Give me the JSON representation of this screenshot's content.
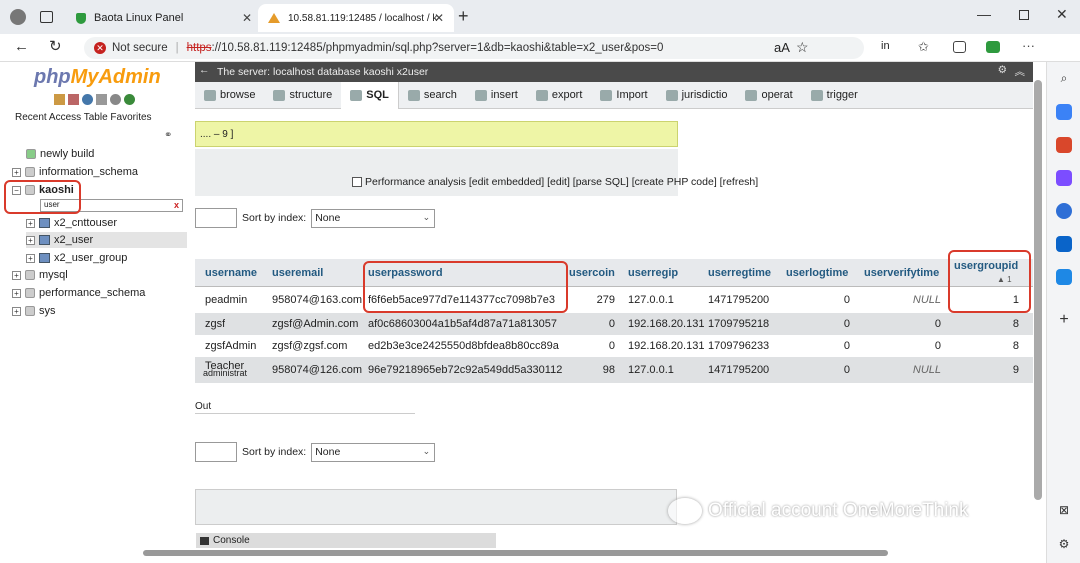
{
  "browser": {
    "tabs": [
      {
        "label": "Baota Linux Panel"
      },
      {
        "label": "10.58.81.119:12485 / localhost / k"
      }
    ],
    "security": "Not secure",
    "url_scheme": "https",
    "url_rest": "://10.58.81.119:12485/phpmyadmin/sql.php?server=1&db=kaoshi&table=x2_user&pos=0",
    "read_aloud": "aA",
    "lang": "in"
  },
  "sidebar": {
    "logo_php": "php",
    "logo_myadmin": "MyAdmin",
    "recent": "Recent Access Table Favorites",
    "new": "newly build",
    "databases": [
      "information_schema",
      "kaoshi"
    ],
    "filter_value": "user",
    "filter_clear": "x",
    "tables": [
      "x2_cnttouser",
      "x2_user",
      "x2_user_group"
    ],
    "more_databases": [
      "mysql",
      "performance_schema",
      "sys"
    ]
  },
  "main": {
    "server_bar": "The server: localhost database kaoshi x2user",
    "toolbar": [
      {
        "label": "browse"
      },
      {
        "label": "structure"
      },
      {
        "label": "SQL"
      },
      {
        "label": "search"
      },
      {
        "label": "insert"
      },
      {
        "label": "export"
      },
      {
        "label": "Import"
      },
      {
        "label": "jurisdictio"
      },
      {
        "label": "operat"
      },
      {
        "label": "trigger"
      }
    ],
    "notice": ".... – 9 ]",
    "perf_links": "Performance analysis [edit embedded] [edit] [parse SQL] [create PHP code] [refresh]",
    "sort_label": "Sort by index:",
    "sort_value": "None",
    "out_label": "Out",
    "console_label": "Console"
  },
  "grid": {
    "columns": [
      "username",
      "useremail",
      "userpassword",
      "usercoin",
      "userregip",
      "userregtime",
      "userlogtime",
      "userverifytime",
      "usergroupid"
    ],
    "sort_indicator": "▲ 1",
    "rows": [
      [
        "peadmin",
        "958074@163.com",
        "f6f6eb5ace977d7e114377cc7098b7e3",
        "279",
        "127.0.0.1",
        "1471795200",
        "0",
        "NULL",
        "1"
      ],
      [
        "zgsf",
        "zgsf@Admin.com",
        "af0c68603004a1b5af4d87a71a813057",
        "0",
        "192.168.20.131",
        "1709795218",
        "0",
        "0",
        "8"
      ],
      [
        "zgsfAdmin",
        "zgsf@zgsf.com",
        "ed2b3e3ce2425550d8bfdea8b80cc89a",
        "0",
        "192.168.20.131",
        "1709796233",
        "0",
        "0",
        "8"
      ],
      [
        "Teacher",
        "958074@126.com",
        "96e79218965eb72c92a549dd5a330112",
        "98",
        "127.0.0.1",
        "1471795200",
        "0",
        "NULL",
        "9"
      ]
    ],
    "overlap_text": "administrat"
  },
  "watermark": "Official account OneMoreThink"
}
